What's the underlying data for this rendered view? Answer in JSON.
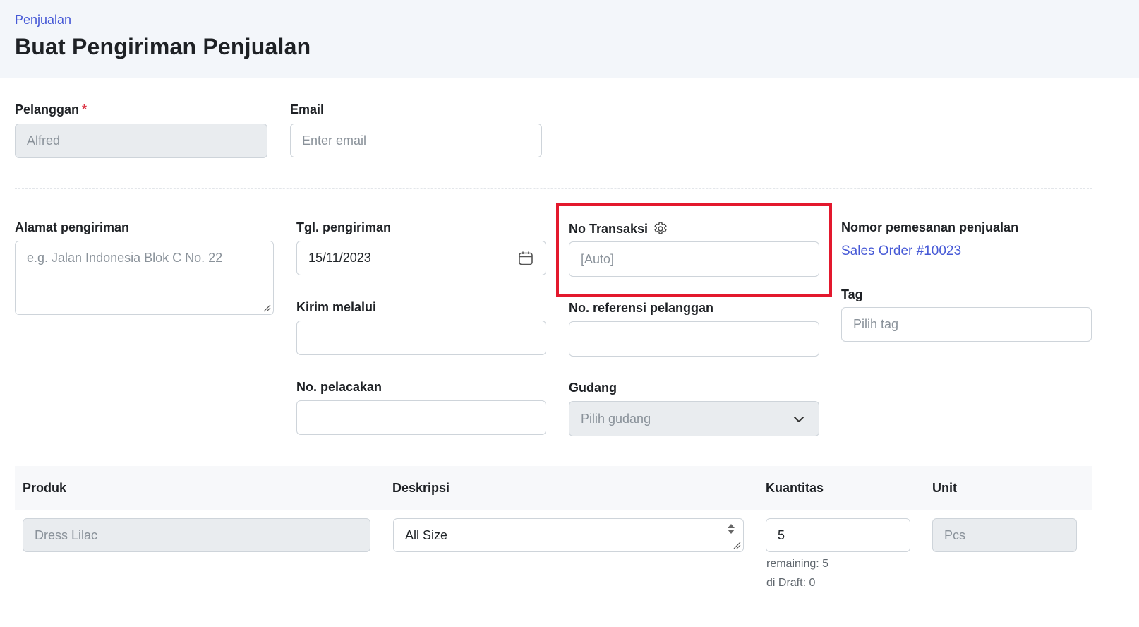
{
  "header": {
    "breadcrumb": "Penjualan",
    "title": "Buat Pengiriman Penjualan"
  },
  "form": {
    "customer": {
      "label": "Pelanggan",
      "required_mark": "*",
      "value": "Alfred"
    },
    "email": {
      "label": "Email",
      "placeholder": "Enter email"
    },
    "shipping_address": {
      "label": "Alamat pengiriman",
      "placeholder": "e.g. Jalan Indonesia Blok C No. 22"
    },
    "shipping_date": {
      "label": "Tgl. pengiriman",
      "value": "15/11/2023"
    },
    "ship_via": {
      "label": "Kirim melalui",
      "value": ""
    },
    "tracking_no": {
      "label": "No. pelacakan",
      "value": ""
    },
    "transaction_no": {
      "label": "No Transaksi",
      "placeholder": "[Auto]"
    },
    "customer_ref": {
      "label": "No. referensi pelanggan",
      "value": ""
    },
    "warehouse": {
      "label": "Gudang",
      "placeholder": "Pilih gudang"
    },
    "sales_order": {
      "label": "Nomor pemesanan penjualan",
      "link": "Sales Order #10023"
    },
    "tag": {
      "label": "Tag",
      "placeholder": "Pilih tag"
    }
  },
  "table": {
    "columns": [
      "Produk",
      "Deskripsi",
      "Kuantitas",
      "Unit"
    ],
    "rows": [
      {
        "product": "Dress Lilac",
        "description": "All Size",
        "quantity": "5",
        "unit": "Pcs",
        "remaining": "remaining: 5",
        "draft": "di Draft: 0"
      }
    ]
  },
  "icons": {
    "calendar": "calendar-icon",
    "settings": "gear-icon",
    "dropdown": "chevron-down-icon"
  },
  "colors": {
    "accent": "#4659d6",
    "highlight": "#e3182d",
    "required": "#dc3545"
  }
}
